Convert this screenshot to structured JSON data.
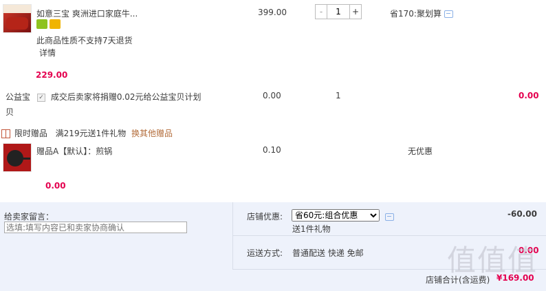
{
  "item": {
    "title": "如意三宝 爽洲进口家庭牛...",
    "no_return_note": "此商品性质不支持7天退货",
    "details_link": "详情",
    "subtotal": "229.00",
    "unit_price": "399.00",
    "quantity": "1",
    "minus": "-",
    "plus": "+",
    "discount_text": "省170:聚划算"
  },
  "charity": {
    "label": "公益宝贝",
    "text": "成交后卖家将捐赠0.02元给公益宝贝计划",
    "price": "0.00",
    "qty": "1",
    "total": "0.00"
  },
  "gift_promo": {
    "label": "限时赠品",
    "rule": "满219元送1件礼物",
    "change_link": "换其他赠品"
  },
  "gift_item": {
    "title": "赠品A【默认】：煎锅",
    "price": "0.10",
    "discount": "无优惠",
    "subtotal": "0.00"
  },
  "remark": {
    "label": "给卖家留言：",
    "placeholder": "选填:填写内容已和卖家协商确认"
  },
  "shop_promo": {
    "label": "店铺优惠:",
    "selected": "省60元:组合优惠",
    "gift": "送1件礼物",
    "amount": "-60.00"
  },
  "shipping": {
    "label": "运送方式:",
    "value": "普通配送 快递 免邮",
    "amount": "0.00"
  },
  "total": {
    "label": "店铺合计(含运费)",
    "value": "¥169.00"
  },
  "colors": {
    "price_red": "#e4004f",
    "link_orange": "#b36d3b",
    "bottom_bg": "#eef2fb"
  },
  "icons": [
    "gift-icon",
    "chat-icon",
    "checkbox-icon",
    "badge-icon"
  ]
}
